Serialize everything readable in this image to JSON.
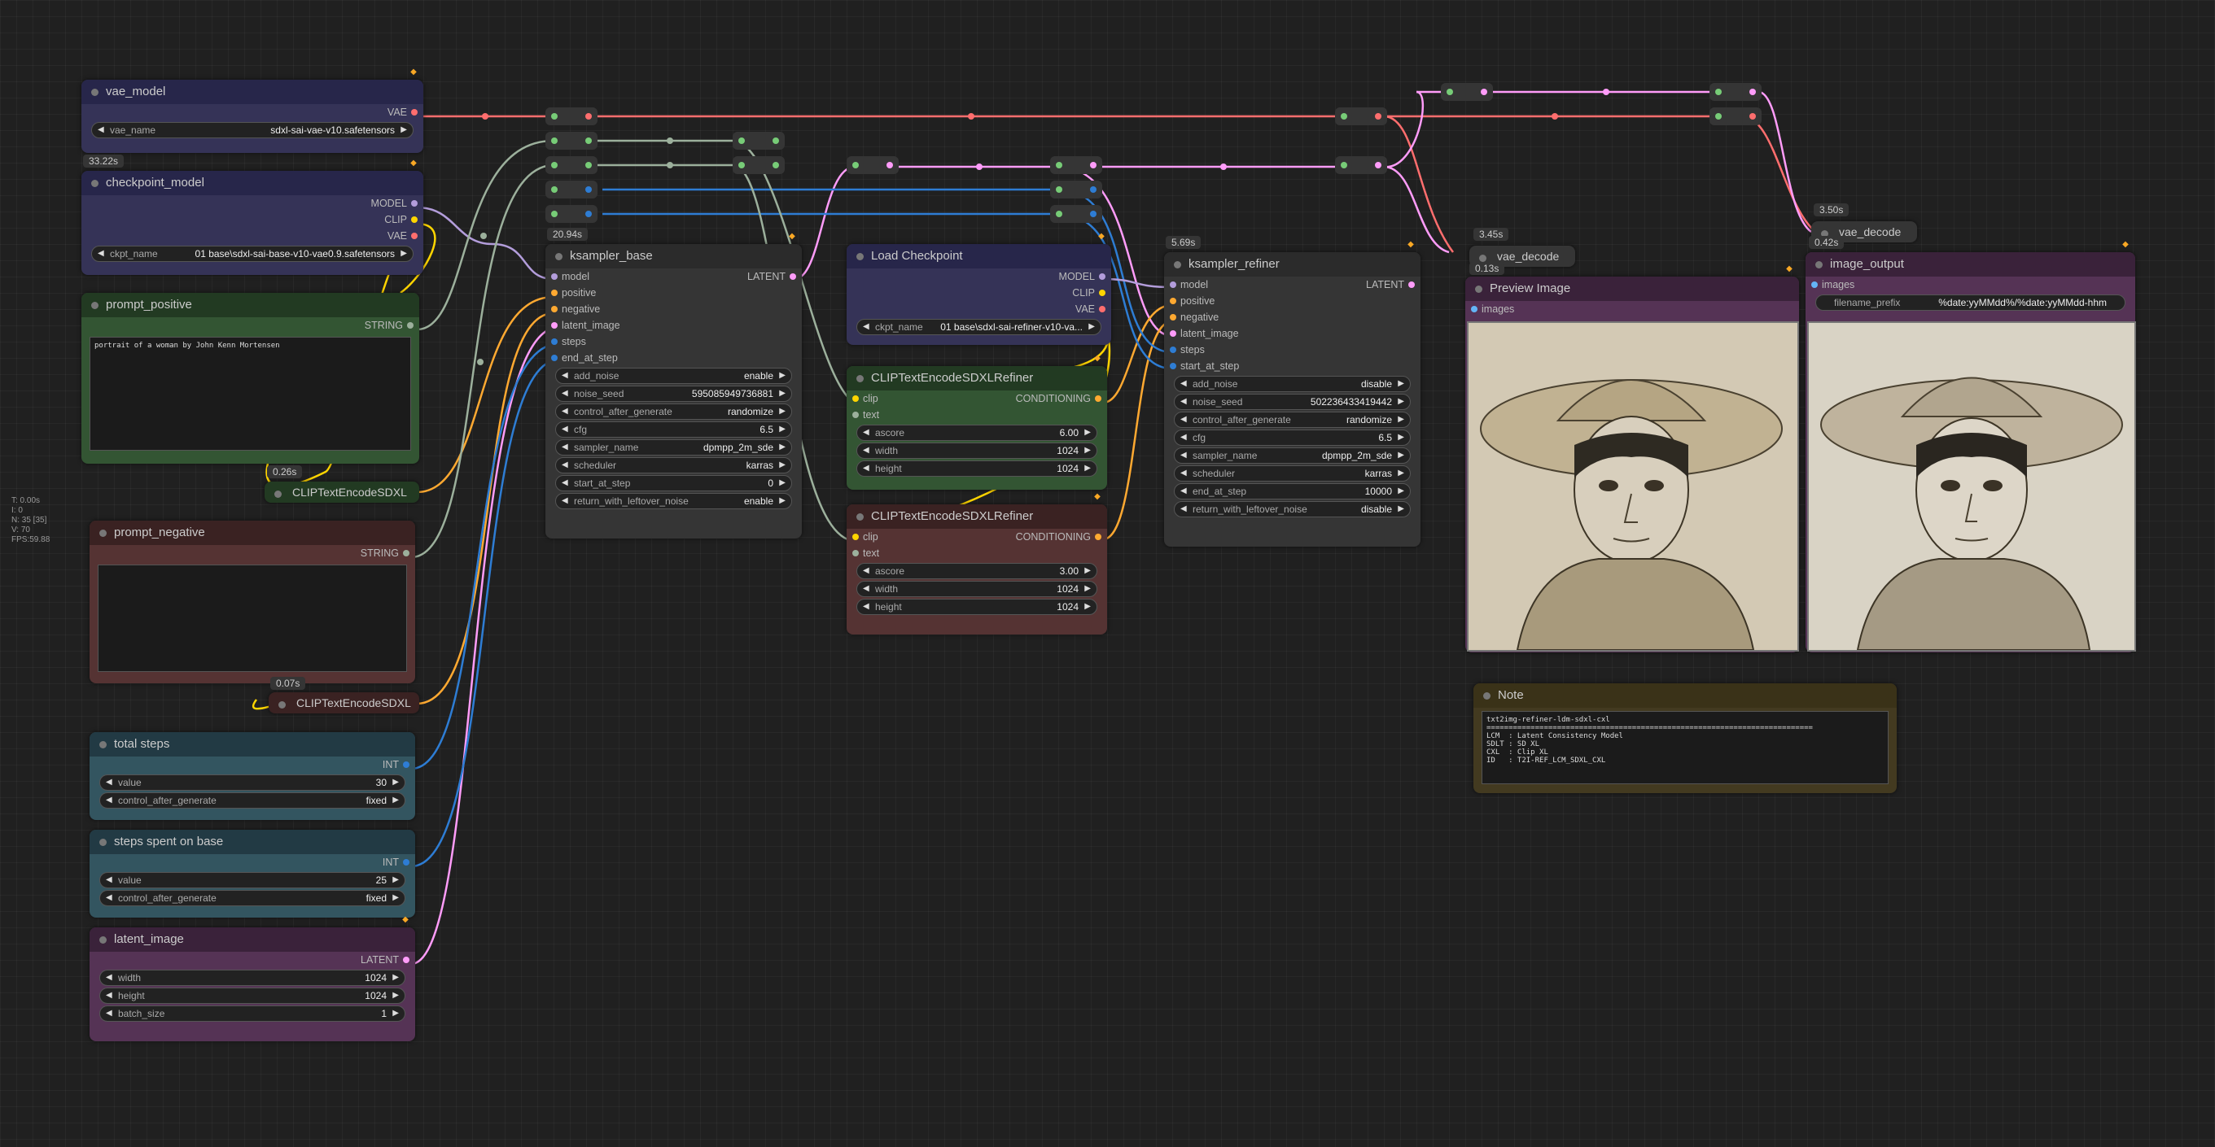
{
  "stats": [
    "T: 0.00s",
    "I: 0",
    "N: 35 [35]",
    "V: 70",
    "FPS:59.88"
  ],
  "nodes": {
    "vae_model": {
      "title": "vae_model",
      "out": "VAE",
      "w_label": "vae_name",
      "w_value": "sdxl-sai-vae-v10.safetensors"
    },
    "checkpoint_model": {
      "time": "33.22s",
      "title": "checkpoint_model",
      "out1": "MODEL",
      "out2": "CLIP",
      "out3": "VAE",
      "w_label": "ckpt_name",
      "w_value": "01 base\\sdxl-sai-base-v10-vae0.9.safetensors"
    },
    "prompt_positive": {
      "title": "prompt_positive",
      "out": "STRING",
      "text": "portrait of a woman by John Kenn Mortensen"
    },
    "clip_pos": {
      "time": "0.26s",
      "title": "CLIPTextEncodeSDXL"
    },
    "prompt_negative": {
      "title": "prompt_negative",
      "out": "STRING",
      "text": ""
    },
    "clip_neg": {
      "time": "0.07s",
      "title": "CLIPTextEncodeSDXL"
    },
    "total_steps": {
      "title": "total steps",
      "out": "INT",
      "w1_label": "value",
      "w1_value": "30",
      "w2_label": "control_after_generate",
      "w2_value": "fixed"
    },
    "steps_base": {
      "title": "steps spent on base",
      "out": "INT",
      "w1_label": "value",
      "w1_value": "25",
      "w2_label": "control_after_generate",
      "w2_value": "fixed"
    },
    "latent_image": {
      "title": "latent_image",
      "out": "LATENT",
      "w1_label": "width",
      "w1_value": "1024",
      "w2_label": "height",
      "w2_value": "1024",
      "w3_label": "batch_size",
      "w3_value": "1"
    },
    "ksampler_base": {
      "time": "20.94s",
      "title": "ksampler_base",
      "out": "LATENT",
      "inputs": [
        "model",
        "positive",
        "negative",
        "latent_image",
        "steps",
        "end_at_step"
      ],
      "widgets": [
        {
          "label": "add_noise",
          "value": "enable"
        },
        {
          "label": "noise_seed",
          "value": "595085949736881"
        },
        {
          "label": "control_after_generate",
          "value": "randomize"
        },
        {
          "label": "cfg",
          "value": "6.5"
        },
        {
          "label": "sampler_name",
          "value": "dpmpp_2m_sde"
        },
        {
          "label": "scheduler",
          "value": "karras"
        },
        {
          "label": "start_at_step",
          "value": "0"
        },
        {
          "label": "return_with_leftover_noise",
          "value": "enable"
        }
      ]
    },
    "load_checkpoint": {
      "title": "Load Checkpoint",
      "out1": "MODEL",
      "out2": "CLIP",
      "out3": "VAE",
      "w_label": "ckpt_name",
      "w_value": "01 base\\sdxl-sai-refiner-v10-va..."
    },
    "clip_refiner_pos": {
      "title": "CLIPTextEncodeSDXLRefiner",
      "in1": "clip",
      "in2": "text",
      "out": "CONDITIONING",
      "w1_label": "ascore",
      "w1_value": "6.00",
      "w2_label": "width",
      "w2_value": "1024",
      "w3_label": "height",
      "w3_value": "1024"
    },
    "clip_refiner_neg": {
      "title": "CLIPTextEncodeSDXLRefiner",
      "in1": "clip",
      "in2": "text",
      "out": "CONDITIONING",
      "w1_label": "ascore",
      "w1_value": "3.00",
      "w2_label": "width",
      "w2_value": "1024",
      "w3_label": "height",
      "w3_value": "1024"
    },
    "ksampler_refiner": {
      "time": "5.69s",
      "title": "ksampler_refiner",
      "out": "LATENT",
      "inputs": [
        "model",
        "positive",
        "negative",
        "latent_image",
        "steps",
        "start_at_step"
      ],
      "widgets": [
        {
          "label": "add_noise",
          "value": "disable"
        },
        {
          "label": "noise_seed",
          "value": "502236433419442"
        },
        {
          "label": "control_after_generate",
          "value": "randomize"
        },
        {
          "label": "cfg",
          "value": "6.5"
        },
        {
          "label": "sampler_name",
          "value": "dpmpp_2m_sde"
        },
        {
          "label": "scheduler",
          "value": "karras"
        },
        {
          "label": "end_at_step",
          "value": "10000"
        },
        {
          "label": "return_with_leftover_noise",
          "value": "disable"
        }
      ]
    },
    "vae_decode_1": {
      "time": "3.45s",
      "title": "vae_decode"
    },
    "preview_image": {
      "time": "0.13s",
      "title": "Preview Image",
      "in": "images"
    },
    "vae_decode_2": {
      "time": "3.50s",
      "title": "vae_decode"
    },
    "image_output": {
      "time": "0.42s",
      "title": "image_output",
      "in": "images",
      "w_label": "filename_prefix",
      "w_value": "%date:yyMMdd%/%date:yyMMdd-hhm"
    },
    "note": {
      "title": "Note",
      "text": "txt2img-refiner-ldm-sdxl-cxl\n==========================================================================\nLCM  : Latent Consistency Model\nSDLT : SD XL\nCXL  : Clip XL\nID   : T2I-REF_LCM_SDXL_CXL"
    }
  },
  "colors": {
    "vae": "#ff6e6e",
    "model": "#b39ddb",
    "clip": "#ffd500",
    "latent": "#ff9cf9",
    "int": "#2e7dd4",
    "string": "#9cb09c",
    "conditioning": "#ffa931",
    "reroute": "#7ccc7c"
  }
}
